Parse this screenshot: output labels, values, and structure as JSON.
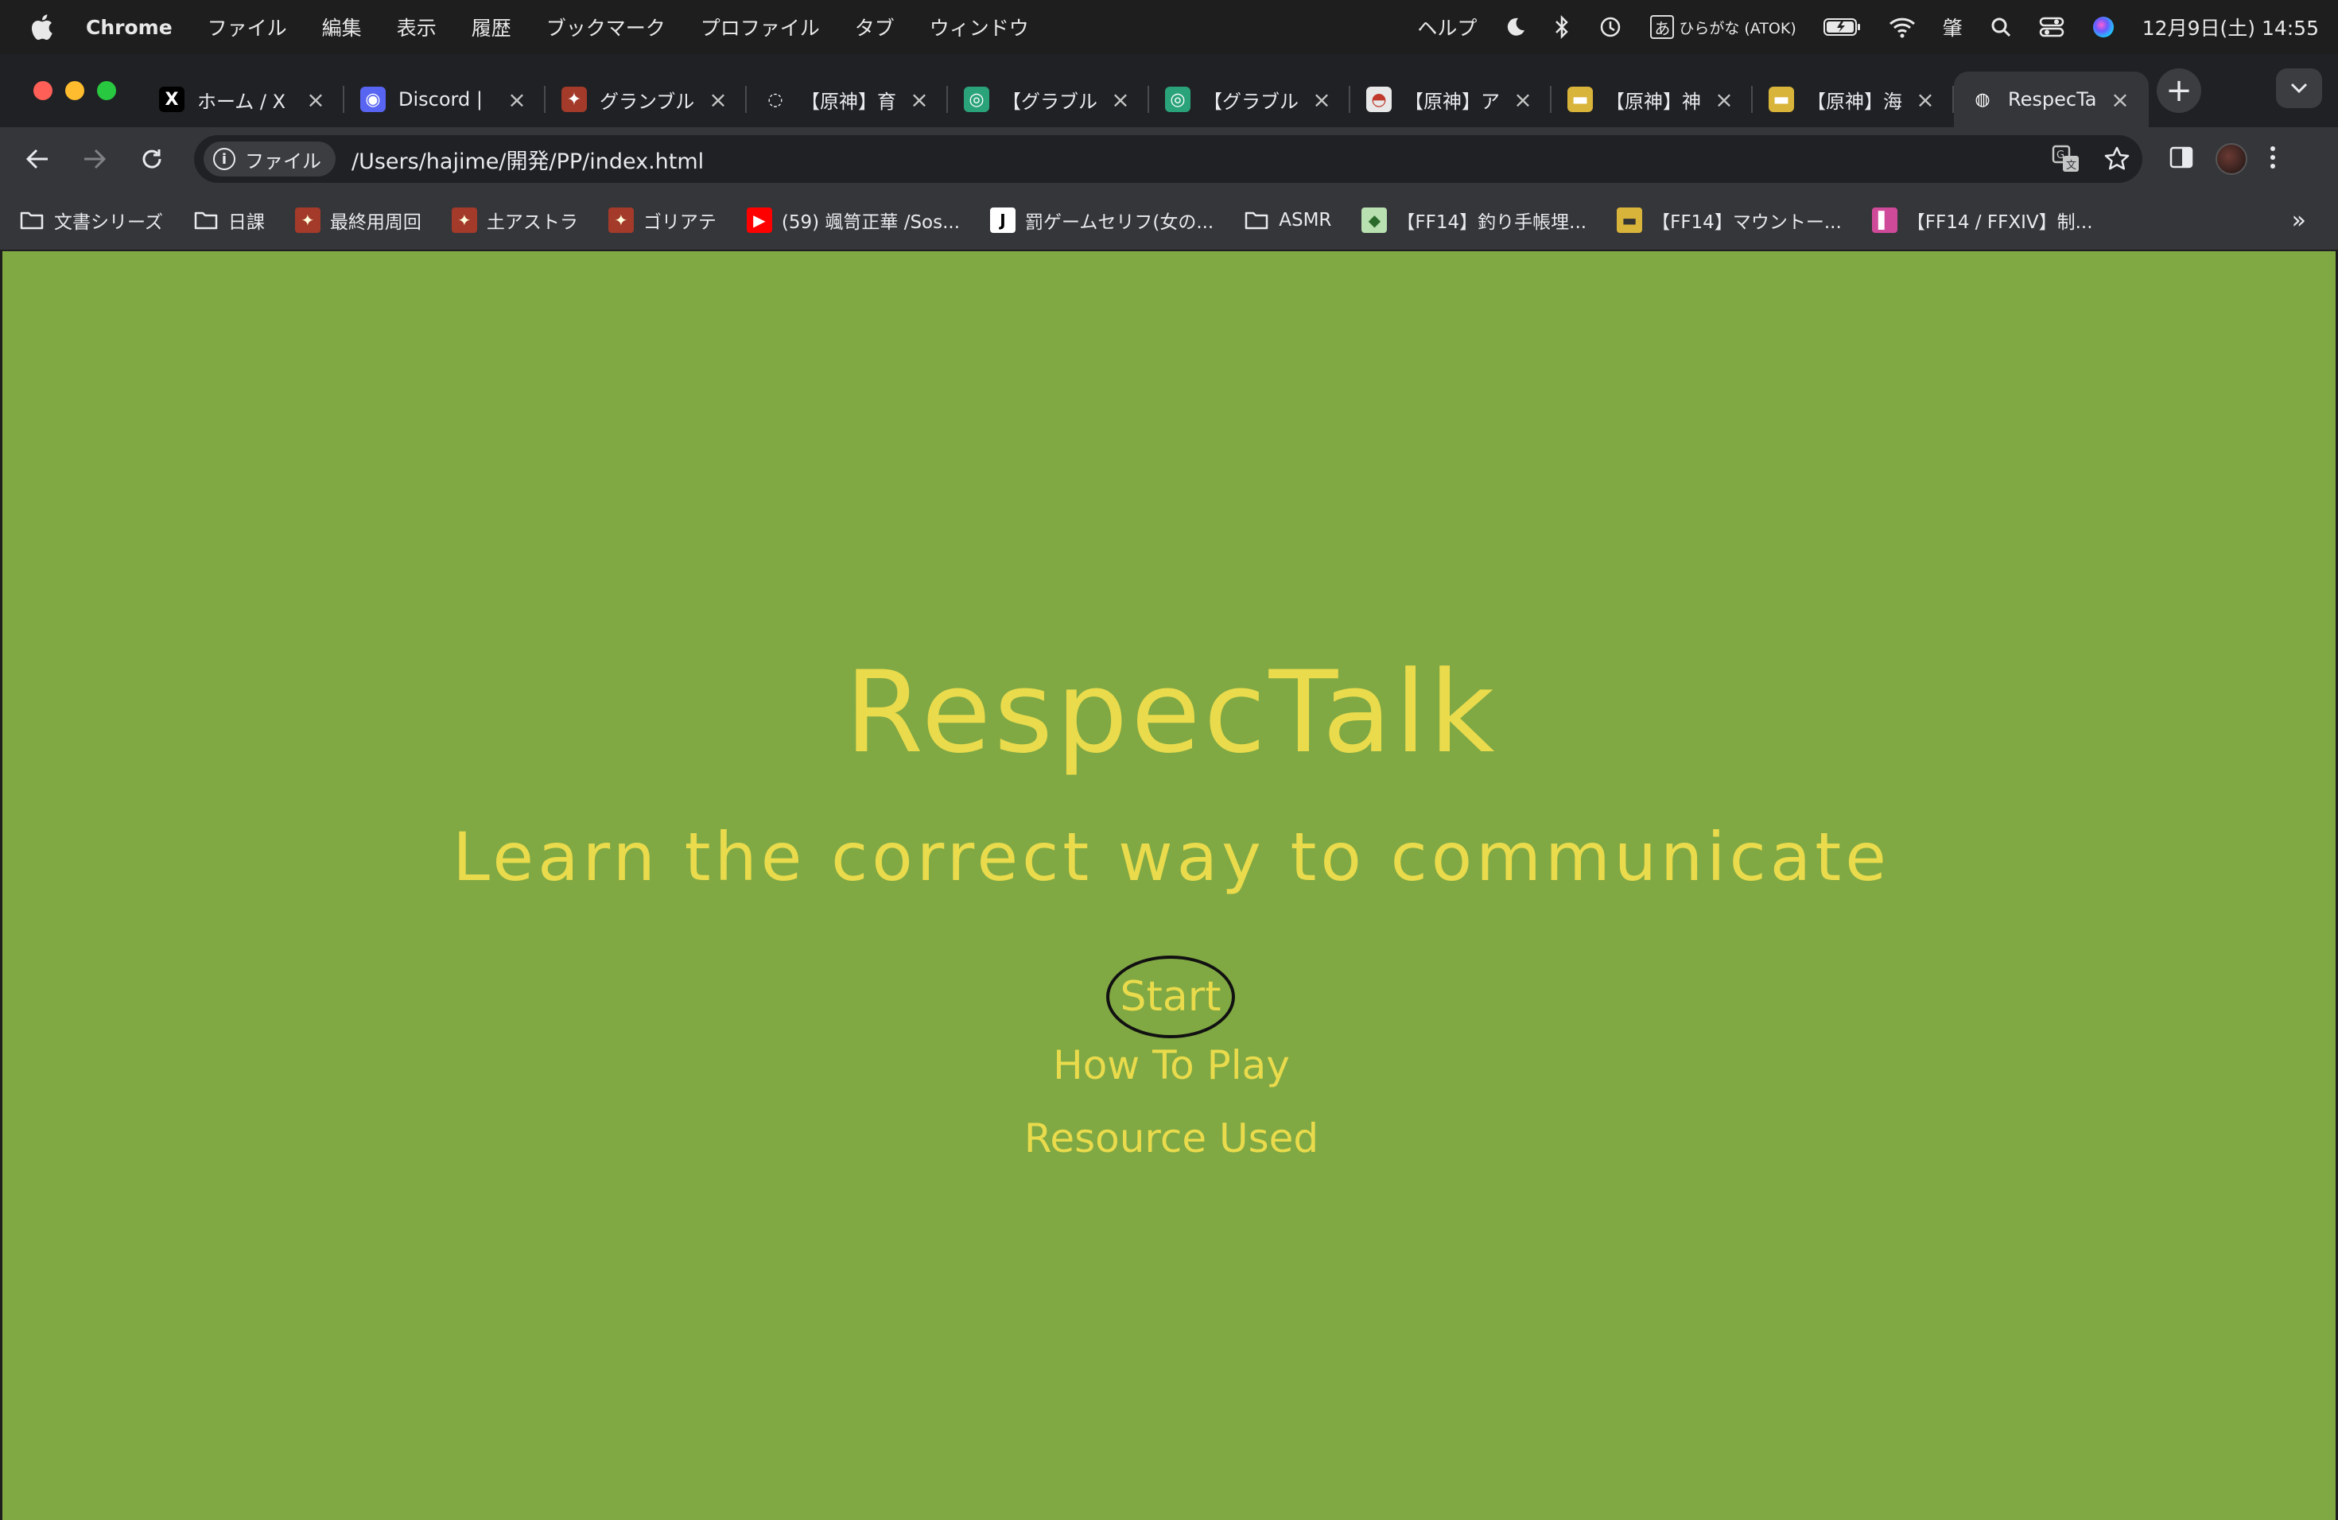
{
  "menubar": {
    "app_name": "Chrome",
    "items": [
      "ファイル",
      "編集",
      "表示",
      "履歴",
      "ブックマーク",
      "プロファイル",
      "タブ",
      "ウィンドウ"
    ],
    "help": "ヘルプ",
    "ime_label": "ひらがな (ATOK)",
    "ime_glyph": "あ",
    "kanji_indicator": "肇",
    "clock": "12月9日(土) 14:55"
  },
  "tabs": [
    {
      "title": "ホーム / X",
      "icon": "x-logo-icon",
      "fav_text": "X",
      "fav_color": "#000000"
    },
    {
      "title": "Discord |",
      "icon": "discord-icon",
      "fav_text": "◉",
      "fav_color": "#5865f2"
    },
    {
      "title": "グランブル",
      "icon": "granblue-icon",
      "fav_text": "✦",
      "fav_color": "#a33a2a"
    },
    {
      "title": "【原神】育",
      "icon": "loading-spinner-icon",
      "fav_text": "◌",
      "fav_color": "#202124"
    },
    {
      "title": "【グラブル",
      "icon": "game8-icon",
      "fav_text": "◎",
      "fav_color": "#2aa37a"
    },
    {
      "title": "【グラブル",
      "icon": "game8-icon",
      "fav_text": "◎",
      "fav_color": "#2aa37a"
    },
    {
      "title": "【原神】ア",
      "icon": "genshin-wiki-icon",
      "fav_text": "◓",
      "fav_color": "#e8e8e8"
    },
    {
      "title": "【原神】神",
      "icon": "gamewith-icon",
      "fav_text": "▬",
      "fav_color": "#d9b43a"
    },
    {
      "title": "【原神】海",
      "icon": "gamewith-icon",
      "fav_text": "▬",
      "fav_color": "#d9b43a"
    },
    {
      "title": "RespecTa",
      "icon": "globe-icon",
      "fav_text": "◍",
      "fav_color": "#35363a",
      "active": true
    }
  ],
  "toolbar": {
    "chip_label": "ファイル",
    "url": "/Users/hajime/開発/PP/index.html"
  },
  "bookmarks": [
    {
      "label": "文書シリーズ",
      "icon": "folder-icon"
    },
    {
      "label": "日課",
      "icon": "folder-icon"
    },
    {
      "label": "最終用周回",
      "icon": "granblue-icon"
    },
    {
      "label": "土アストラ",
      "icon": "granblue-icon"
    },
    {
      "label": "ゴリアテ",
      "icon": "granblue-icon"
    },
    {
      "label": "(59) 颯笥正華 /Sos...",
      "icon": "youtube-icon"
    },
    {
      "label": "罰ゲームセリフ(女の...",
      "icon": "j-icon"
    },
    {
      "label": "ASMR",
      "icon": "folder-icon"
    },
    {
      "label": "【FF14】釣り手帳埋...",
      "icon": "ff14-fishing-icon"
    },
    {
      "label": "【FF14】マウントー...",
      "icon": "gamewith-icon"
    },
    {
      "label": "【FF14 / FFXIV】制...",
      "icon": "ff14-pink-icon"
    }
  ],
  "page": {
    "title": "RespecTalk",
    "subtitle": "Learn the correct way to communicate",
    "start_label": "Start",
    "how_to_play_label": "How To Play",
    "resource_label": "Resource Used"
  },
  "colors": {
    "page_background": "#80a843",
    "accent_text": "#e9db4c",
    "chrome_dark": "#202124",
    "chrome_toolbar": "#35363a"
  }
}
